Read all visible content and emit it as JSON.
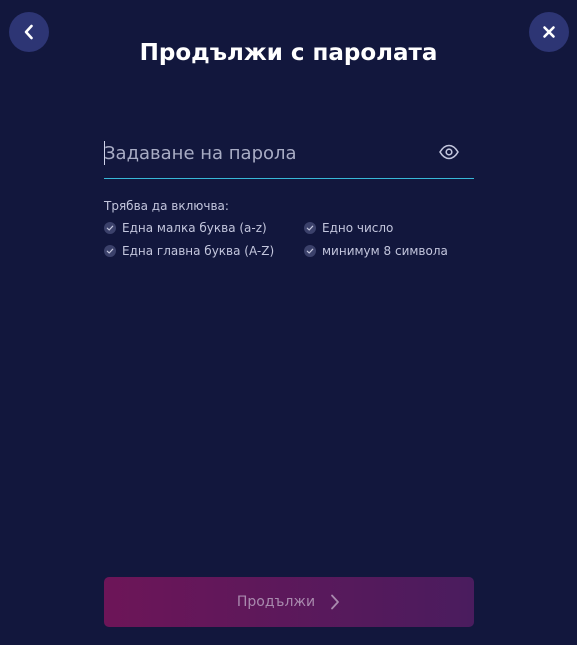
{
  "header": {
    "title": "Продължи с паролата",
    "back_icon": "chevron-left-icon",
    "close_icon": "close-icon"
  },
  "password_field": {
    "placeholder": "Задаване на парола",
    "value": "",
    "toggle_icon": "eye-icon"
  },
  "requirements": {
    "title": "Трябва да включва:",
    "items": [
      {
        "label": "Една малка буква (a-z)",
        "icon": "check-icon"
      },
      {
        "label": "Едно число",
        "icon": "check-icon"
      },
      {
        "label": "Една главна буква (A-Z)",
        "icon": "check-icon"
      },
      {
        "label": "минимум 8 символа",
        "icon": "check-icon"
      }
    ]
  },
  "submit": {
    "label": "Продължи",
    "icon": "chevron-right-icon",
    "gradient": [
      "#6d1558",
      "#4a1c5e"
    ]
  },
  "colors": {
    "background": "#12173d",
    "accent_underline": "#38b8d8",
    "circle_button": "#2d3574"
  }
}
